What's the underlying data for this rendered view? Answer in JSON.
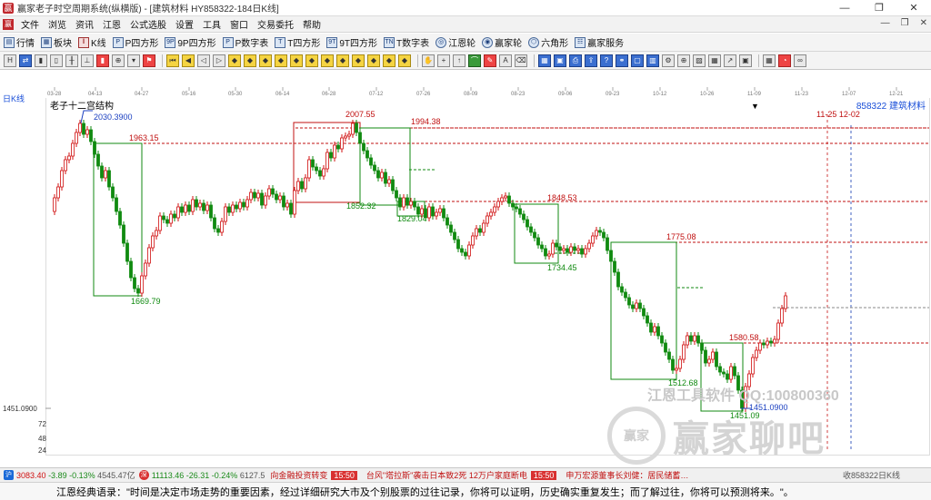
{
  "window": {
    "title": "赢家老子时空周期系统(纵横版) - [建筑材料  HY858322-184日K线]",
    "controls": [
      "—",
      "❐",
      "✕"
    ]
  },
  "menu": {
    "items": [
      "文件",
      "浏览",
      "资讯",
      "江恩",
      "公式选股",
      "设置",
      "工具",
      "窗口",
      "交易委托",
      "帮助"
    ],
    "mdi_controls": [
      "—",
      "❐",
      "✕"
    ]
  },
  "toolbar1": {
    "items": [
      {
        "label": "行情",
        "icon": "quote-icon"
      },
      {
        "label": "板块",
        "icon": "sector-icon"
      },
      {
        "label": "K线",
        "icon": "kline-icon"
      },
      {
        "label": "P四方形",
        "icon": "p-square-icon"
      },
      {
        "label": "9P四方形",
        "icon": "9p-square-icon"
      },
      {
        "label": "P数字表",
        "icon": "p-table-icon"
      },
      {
        "label": "T四方形",
        "icon": "t-square-icon"
      },
      {
        "label": "9T四方形",
        "icon": "9t-square-icon"
      },
      {
        "label": "T数字表",
        "icon": "t-table-icon"
      },
      {
        "label": "江恩轮",
        "icon": "gann-wheel-icon"
      },
      {
        "label": "赢家轮",
        "icon": "winner-wheel-icon"
      },
      {
        "label": "六角形",
        "icon": "hexagon-icon"
      },
      {
        "label": "赢家服务",
        "icon": "service-icon"
      }
    ]
  },
  "chart": {
    "period_label": "日K线",
    "structure_label": "老子十二宫结构",
    "code_label": "858322  建筑材料",
    "dates": [
      "03-28",
      "04-13",
      "04-27",
      "05-16",
      "05-30",
      "06-14",
      "06-28",
      "07-12",
      "07-26",
      "08-09",
      "08-23",
      "09-06",
      "09-23",
      "10-12",
      "10-26",
      "11-09",
      "11-23",
      "12-07",
      "12-21"
    ],
    "future_dates_label": "11-25 12-02",
    "y_axis_labels": [
      "1451.0900",
      "72",
      "48",
      "24"
    ],
    "price_annotations": [
      "2030.3900",
      "2007.55",
      "1994.38",
      "1963.15",
      "1848.53",
      "1775.08",
      "1580.58",
      "1852.32",
      "1829.04",
      "1734.45",
      "1669.79",
      "1512.68",
      "1451.09",
      "1451.0900"
    ],
    "accent_up": "#d01010",
    "accent_down": "#108a10"
  },
  "watermark": {
    "line1": "江恩工具软件  QQ:100800360",
    "logo_text": "赢家",
    "brand": "赢家聊吧"
  },
  "ticker": {
    "sh_value": "3083.40",
    "sh_change": "-3.89",
    "sh_pct": "-0.13%",
    "sh_volume": "4545.47亿",
    "sz_value": "11113.46",
    "sz_change": "-26.31",
    "sz_pct": "-0.24%",
    "sz_volume": "6127.5",
    "news1": "向金融投资转变",
    "time1": "15:50",
    "news2": "台风\"塔拉斯\"袭击日本致2死 12万户家庭断电",
    "time2": "15:50",
    "news3": "申万宏源董事长刘健：居民储蓄…",
    "right_label": "收858322日K线"
  },
  "quote": {
    "text": "江恩经典语录：\"时间是决定市场走势的重要因素，经过详细研究大市及个别股票的过往记录，你将可以证明，历史确实重复发生；而了解过往，你将可以预测将来。\"。"
  }
}
